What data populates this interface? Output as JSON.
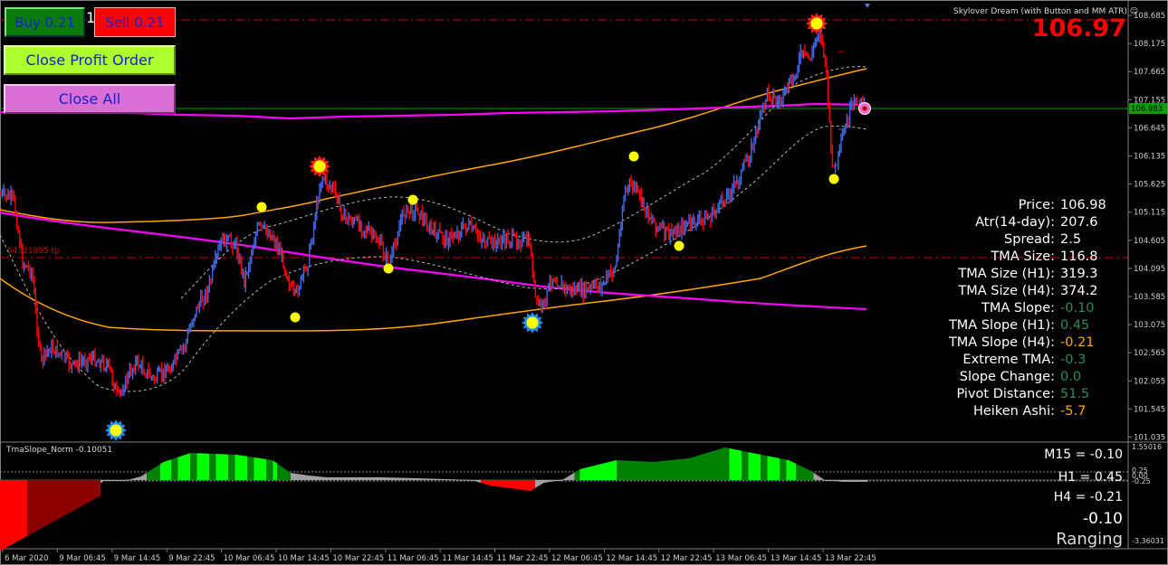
{
  "buttons": {
    "buy_label": "Buy 0.21",
    "sell_label": "Sell 0.21",
    "lot_digit": "1",
    "close_profit_label": "Close Profit Order",
    "close_all_label": "Close All"
  },
  "indicator_name": "Skylover Dream (with Button and MM ATR)",
  "big_price": "106.97",
  "price_axis": {
    "ticks": [
      "108.685",
      "108.175",
      "107.665",
      "107.155",
      "106.645",
      "106.135",
      "105.625",
      "105.115",
      "104.605",
      "104.095",
      "103.585",
      "103.075",
      "102.565",
      "102.055",
      "101.545",
      "101.035"
    ],
    "current_price_tag": "106.983"
  },
  "tp_label": "54321895 tp",
  "stats": [
    {
      "label": "Price:",
      "value": "106.98",
      "color": "#ffffff"
    },
    {
      "label": "Atr(14-day):",
      "value": "207.6",
      "color": "#ffffff"
    },
    {
      "label": "Spread:",
      "value": "2.5",
      "color": "#ffffff"
    },
    {
      "label": "TMA Size:",
      "value": "116.8",
      "color": "#ffffff"
    },
    {
      "label": "TMA Size (H1):",
      "value": "319.3",
      "color": "#ffffff"
    },
    {
      "label": "TMA Size (H4):",
      "value": "374.2",
      "color": "#ffffff"
    },
    {
      "label": "TMA Slope:",
      "value": "-0.10",
      "color": "#2e8b57"
    },
    {
      "label": "TMA Slope (H1):",
      "value": "0.45",
      "color": "#2e8b57"
    },
    {
      "label": "TMA Slope (H4):",
      "value": "-0.21",
      "color": "#ffa500"
    },
    {
      "label": "Extreme TMA:",
      "value": "-0.3",
      "color": "#2e8b57"
    },
    {
      "label": "Slope Change:",
      "value": "0.0",
      "color": "#2e8b57"
    },
    {
      "label": "Pivot Distance:",
      "value": "51.5",
      "color": "#2e8b57"
    },
    {
      "label": "Heiken Ashi:",
      "value": "-5.7",
      "color": "#ffa500"
    }
  ],
  "subwindow": {
    "title": "TmaSlope_Norm -0.10051",
    "m15_label": "M15 = -0.10",
    "h1_label": "H1 = 0.45",
    "h4_label": "H4 = -0.21",
    "slope_value": "-0.10",
    "state": "Ranging",
    "axis_ticks": [
      "1.55016",
      "0.25",
      "0.00",
      "-0.25",
      "-3.36031"
    ]
  },
  "time_axis": [
    "6 Mar 2020",
    "9 Mar 06:45",
    "9 Mar 14:45",
    "9 Mar 22:45",
    "10 Mar 06:45",
    "10 Mar 14:45",
    "10 Mar 22:45",
    "11 Mar 06:45",
    "11 Mar 14:45",
    "11 Mar 22:45",
    "12 Mar 06:45",
    "12 Mar 14:45",
    "12 Mar 22:45",
    "13 Mar 06:45",
    "13 Mar 14:45",
    "13 Mar 22:45"
  ],
  "colors": {
    "background": "#000000",
    "bull_candle": "#4169e1",
    "bear_candle": "#ff0000",
    "tma_line": "#ff00ff",
    "band_line": "#ffa500",
    "pivot_dot": "#ffff00",
    "hist_green": "#00ff00",
    "hist_dark_green": "#008000",
    "hist_red": "#ff0000",
    "hist_dark_red": "#8b0000",
    "hist_gray": "#a0a0a0"
  }
}
